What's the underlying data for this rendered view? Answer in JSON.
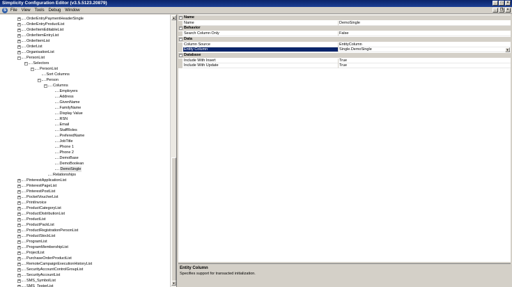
{
  "window": {
    "title": "Simplicity Configuration Editor (v3.5.5123.20879)"
  },
  "menu": {
    "items": [
      "File",
      "View",
      "Tools",
      "Debug",
      "Window"
    ]
  },
  "tree": {
    "rows": [
      {
        "label": "OrderEntryPaymentHeaderSingle",
        "level": 0,
        "exp": "+"
      },
      {
        "label": "OrderEntryProductList",
        "level": 0,
        "exp": "+"
      },
      {
        "label": "OrderItemEditableList",
        "level": 0,
        "exp": "+"
      },
      {
        "label": "OrderItemEntryList",
        "level": 0,
        "exp": "+"
      },
      {
        "label": "OrderItemList",
        "level": 0,
        "exp": "+"
      },
      {
        "label": "OrderList",
        "level": 0,
        "exp": "+"
      },
      {
        "label": "OrganisationList",
        "level": 0,
        "exp": "+"
      },
      {
        "label": "PersonList",
        "level": 0,
        "exp": "-"
      },
      {
        "label": "Selectors",
        "level": 1,
        "exp": "-"
      },
      {
        "label": "PersonList",
        "level": 2,
        "exp": "-"
      },
      {
        "label": "Sort Columns",
        "level": 3,
        "exp": ""
      },
      {
        "label": "Person",
        "level": 3,
        "exp": "-"
      },
      {
        "label": "Columns",
        "level": 4,
        "exp": "-"
      },
      {
        "label": "Employers",
        "level": 5,
        "exp": ""
      },
      {
        "label": "Address",
        "level": 5,
        "exp": ""
      },
      {
        "label": "GivenName",
        "level": 5,
        "exp": ""
      },
      {
        "label": "FamilyName",
        "level": 5,
        "exp": ""
      },
      {
        "label": "Display Value",
        "level": 5,
        "exp": ""
      },
      {
        "label": "RSN",
        "level": 5,
        "exp": ""
      },
      {
        "label": "Email",
        "level": 5,
        "exp": ""
      },
      {
        "label": "StaffRoles",
        "level": 5,
        "exp": ""
      },
      {
        "label": "PreferedName",
        "level": 5,
        "exp": ""
      },
      {
        "label": "JobTitle",
        "level": 5,
        "exp": ""
      },
      {
        "label": "Phone 1",
        "level": 5,
        "exp": ""
      },
      {
        "label": "Phone 2",
        "level": 5,
        "exp": ""
      },
      {
        "label": "DemoBase",
        "level": 5,
        "exp": ""
      },
      {
        "label": "DemoBoolean",
        "level": 5,
        "exp": ""
      },
      {
        "label": "DemoSingle",
        "level": 5,
        "exp": "",
        "selected": true
      },
      {
        "label": "Relationships",
        "level": 4,
        "exp": ""
      },
      {
        "label": "PinterestApplicationList",
        "level": 0,
        "exp": "+"
      },
      {
        "label": "PinterestPageList",
        "level": 0,
        "exp": "+"
      },
      {
        "label": "PinterestPostList",
        "level": 0,
        "exp": "+"
      },
      {
        "label": "PocketVoucherList",
        "level": 0,
        "exp": "+"
      },
      {
        "label": "PrintInvoice",
        "level": 0,
        "exp": "+"
      },
      {
        "label": "ProductCategoryList",
        "level": 0,
        "exp": "+"
      },
      {
        "label": "ProductDistributionList",
        "level": 0,
        "exp": "+"
      },
      {
        "label": "ProductList",
        "level": 0,
        "exp": "+"
      },
      {
        "label": "ProductPackList",
        "level": 0,
        "exp": "+"
      },
      {
        "label": "ProductRegistrationPersonList",
        "level": 0,
        "exp": "+"
      },
      {
        "label": "ProductStockList",
        "level": 0,
        "exp": "+"
      },
      {
        "label": "ProgramList",
        "level": 0,
        "exp": "+"
      },
      {
        "label": "ProgramMembershipList",
        "level": 0,
        "exp": "+"
      },
      {
        "label": "ProjectList",
        "level": 0,
        "exp": "+"
      },
      {
        "label": "PurchaseOrderProductList",
        "level": 0,
        "exp": "+"
      },
      {
        "label": "RemoteCampaignExecutionHistoryList",
        "level": 0,
        "exp": "+"
      },
      {
        "label": "SecurityAccountControlGroupList",
        "level": 0,
        "exp": "+"
      },
      {
        "label": "SecurityAccountList",
        "level": 0,
        "exp": "+"
      },
      {
        "label": "SMS_SymbolList",
        "level": 0,
        "exp": "+"
      },
      {
        "label": "SMS_TesterList",
        "level": 0,
        "exp": "+"
      }
    ]
  },
  "properties": {
    "rows": [
      {
        "kind": "cat",
        "name": "Name"
      },
      {
        "kind": "prop",
        "name": "Name",
        "value": "DemoSingle"
      },
      {
        "kind": "cat",
        "name": "Behavior"
      },
      {
        "kind": "prop",
        "name": "Search Column Only",
        "value": "False"
      },
      {
        "kind": "cat",
        "name": "Data"
      },
      {
        "kind": "prop",
        "name": "Column Source",
        "value": "EntityColumn"
      },
      {
        "kind": "prop",
        "name": "Entity Column",
        "value": "Single.DemoSingle",
        "selected": true,
        "dropdown": true
      },
      {
        "kind": "cat",
        "name": "Database"
      },
      {
        "kind": "prop",
        "name": "Include With Insert",
        "value": "True"
      },
      {
        "kind": "prop",
        "name": "Include With Update",
        "value": "True"
      }
    ]
  },
  "description": {
    "title": "Entity Column",
    "text": "Specifies support for transacted initialization."
  },
  "icons": {
    "minimize": "minimize-icon",
    "maximize": "maximize-icon",
    "close": "close-icon",
    "app": "app-logo-icon"
  }
}
